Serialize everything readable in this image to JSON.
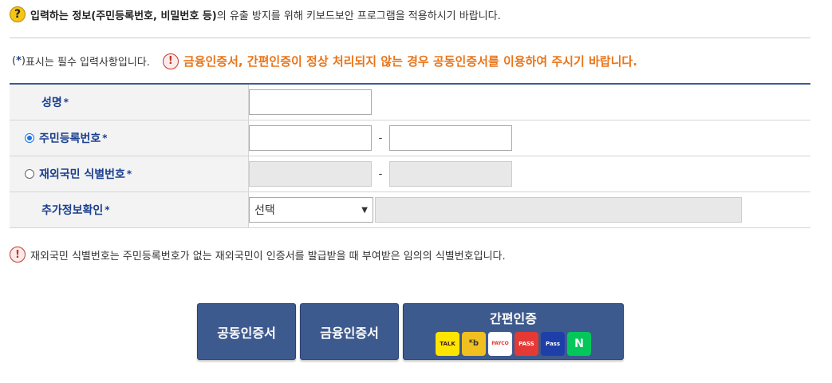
{
  "notice": {
    "icon": "question-icon",
    "bold": "입력하는 정보(주민등록번호, 비밀번호 등)",
    "rest": "의 유출 방지를 위해 키보드보안 프로그램을 적용하시기 바랍니다."
  },
  "required_note": {
    "open": "(",
    "star": "*",
    "close": ")",
    "text": "표시는 필수 입력사항입니다."
  },
  "warning": {
    "icon": "exclamation-icon",
    "text": "금융인증서, 간편인증이 정상 처리되지 않는 경우 공동인증서를 이용하여 주시기 바랍니다."
  },
  "form": {
    "name_label": "성명",
    "rrn_label": "주민등록번호",
    "foreign_label": "재외국민 식별번호",
    "extra_label": "추가정보확인",
    "star": "*",
    "dash": "-",
    "select_value": "선택",
    "rrn_selected": true
  },
  "footnote": {
    "icon": "exclamation-icon",
    "text": "재외국민 식별번호는 주민등록번호가 없는 재외국민이 인증서를 발급받을 때 부여받은 임의의 식별번호입니다."
  },
  "buttons": {
    "joint": "공동인증서",
    "financial": "금융인증서",
    "simple": "간편인증"
  },
  "simple_logos": [
    {
      "name": "kakao",
      "text": "TALK"
    },
    {
      "name": "kb",
      "text": "ᴷb"
    },
    {
      "name": "payco",
      "text": "PAYCO"
    },
    {
      "name": "pass",
      "text": "PASS"
    },
    {
      "name": "samsung-pass",
      "text": "Pass"
    },
    {
      "name": "naver",
      "text": "N"
    }
  ],
  "colors": {
    "accent": "#1a3f8f",
    "warning": "#e9751a",
    "button": "#3d5a8e"
  }
}
